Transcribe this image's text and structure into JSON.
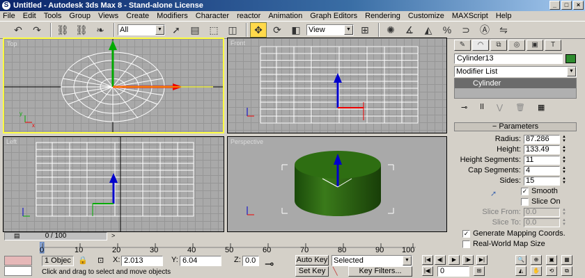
{
  "window": {
    "title": "Untitled - Autodesk 3ds Max 8 - Stand-alone License",
    "app_icon": "3dsmax-icon"
  },
  "menu": [
    "File",
    "Edit",
    "Tools",
    "Group",
    "Views",
    "Create",
    "Modifiers",
    "Character",
    "reactor",
    "Animation",
    "Graph Editors",
    "Rendering",
    "Customize",
    "MAXScript",
    "Help"
  ],
  "toolbar": {
    "selection_filter": "All",
    "reference_coord": "View"
  },
  "viewports": {
    "top": "Top",
    "front": "Front",
    "left": "Left",
    "perspective": "Perspective"
  },
  "command_panel": {
    "object_name": "Cylinder13",
    "object_color": "#2e8b2e",
    "modifier_list": "Modifier List",
    "stack_item": "Cylinder",
    "rollout_title": "Parameters",
    "params": [
      {
        "label": "Radius:",
        "value": "87.286"
      },
      {
        "label": "Height:",
        "value": "133.49"
      },
      {
        "label": "Height Segments:",
        "value": "11"
      },
      {
        "label": "Cap Segments:",
        "value": "4"
      },
      {
        "label": "Sides:",
        "value": "15"
      }
    ],
    "smooth": {
      "label": "Smooth",
      "checked": "✓"
    },
    "slice_on": {
      "label": "Slice On"
    },
    "slice_from": {
      "label": "Slice From:",
      "value": "0.0"
    },
    "slice_to": {
      "label": "Slice To:",
      "value": "0.0"
    },
    "gen_mapping": {
      "label": "Generate Mapping Coords.",
      "checked": "✓"
    },
    "real_world": {
      "label": "Real-World Map Size"
    }
  },
  "timeline": {
    "slider": "0 / 100",
    "ticks": [
      "0",
      "10",
      "20",
      "30",
      "40",
      "50",
      "60",
      "70",
      "80",
      "90",
      "100"
    ]
  },
  "status": {
    "selected_count": "1 Objec",
    "x_label": "X:",
    "x_value": "2.013",
    "y_label": "Y:",
    "y_value": "6.04",
    "z_label": "Z:",
    "z_value": "0.0",
    "auto_key": "Auto Key",
    "set_key": "Set Key",
    "key_mode": "Selected",
    "key_filters": "Key Filters...",
    "frame": "0",
    "prompt": "Click and drag to select and move objects"
  }
}
